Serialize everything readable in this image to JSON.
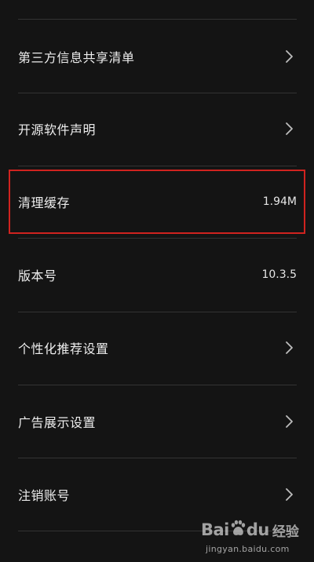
{
  "settings": {
    "items": [
      {
        "label": "第三方信息共享清单",
        "value": null,
        "has_chevron": true
      },
      {
        "label": "开源软件声明",
        "value": null,
        "has_chevron": true
      },
      {
        "label": "清理缓存",
        "value": "1.94M",
        "has_chevron": false
      },
      {
        "label": "版本号",
        "value": "10.3.5",
        "has_chevron": false
      },
      {
        "label": "个性化推荐设置",
        "value": null,
        "has_chevron": true
      },
      {
        "label": "广告展示设置",
        "value": null,
        "has_chevron": true
      },
      {
        "label": "注销账号",
        "value": null,
        "has_chevron": true
      }
    ]
  },
  "highlight": {
    "target_item": "清理缓存",
    "color": "#d0231f"
  },
  "watermark": {
    "brand_left": "Bai",
    "brand_right": "du",
    "brand_suffix": "经验",
    "url": "jingyan.baidu.com"
  },
  "colors": {
    "background": "#141414",
    "text": "#ededed",
    "divider": "#333333",
    "chevron": "#bdbdbd"
  }
}
